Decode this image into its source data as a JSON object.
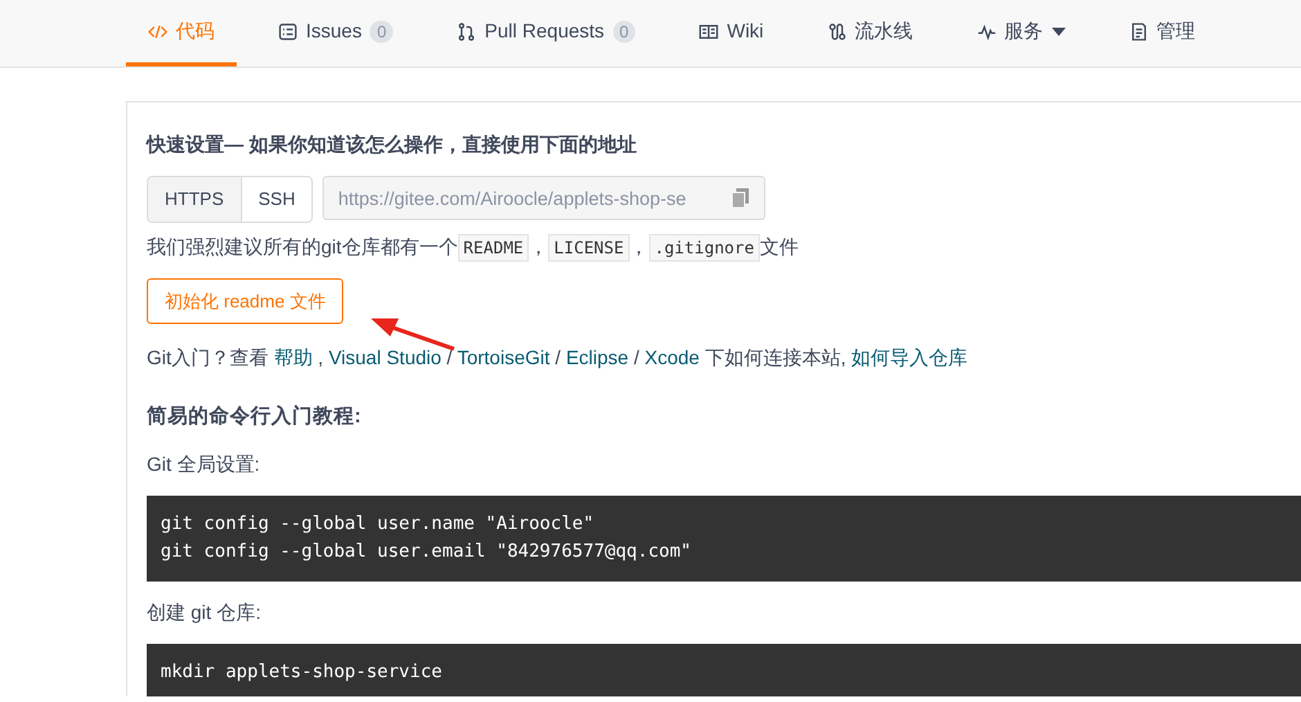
{
  "tabs": [
    {
      "label": "代码",
      "selected": true
    },
    {
      "label": "Issues",
      "count": "0",
      "selected": false
    },
    {
      "label": "Pull Requests",
      "count": "0",
      "selected": false
    },
    {
      "label": "Wiki",
      "selected": false
    },
    {
      "label": "流水线",
      "selected": false
    },
    {
      "label": "服务",
      "dropdown": true,
      "selected": false
    },
    {
      "label": "管理",
      "selected": false
    }
  ],
  "quick_setup": {
    "title": "快速设置— 如果你知道该怎么操作，直接使用下面的地址",
    "protocols": [
      {
        "label": "HTTPS",
        "selected": true
      },
      {
        "label": "SSH",
        "selected": false
      }
    ],
    "url": "https://gitee.com/Airoocle/applets-shop-se",
    "recommend": [
      {
        "kind": "text",
        "text": "我们强烈建议所有的git仓库都有一个"
      },
      {
        "kind": "code",
        "text": "README"
      },
      {
        "kind": "text",
        "text": "，"
      },
      {
        "kind": "code",
        "text": "LICENSE"
      },
      {
        "kind": "text",
        "text": "，"
      },
      {
        "kind": "code",
        "text": ".gitignore"
      },
      {
        "kind": "text",
        "text": "文件"
      }
    ],
    "init_button": "初始化 readme 文件",
    "help": [
      {
        "kind": "text",
        "text": "Git入门？查看 "
      },
      {
        "kind": "link",
        "text": "帮助"
      },
      {
        "kind": "text",
        "text": " , "
      },
      {
        "kind": "link",
        "text": "Visual Studio"
      },
      {
        "kind": "text",
        "text": " / "
      },
      {
        "kind": "link",
        "text": "TortoiseGit"
      },
      {
        "kind": "text",
        "text": " / "
      },
      {
        "kind": "link",
        "text": "Eclipse"
      },
      {
        "kind": "text",
        "text": " / "
      },
      {
        "kind": "link",
        "text": "Xcode"
      },
      {
        "kind": "text",
        "text": " 下如何连接本站, "
      },
      {
        "kind": "link",
        "text": "如何导入仓库"
      }
    ]
  },
  "tutorial": {
    "title": "简易的命令行入门教程:",
    "sections": [
      {
        "label": "Git 全局设置:",
        "code": [
          "git config --global user.name \"Airoocle\"",
          "git config --global user.email \"842976577@qq.com\""
        ]
      },
      {
        "label": "创建 git 仓库:",
        "code": [
          "mkdir applets-shop-service"
        ]
      }
    ]
  }
}
